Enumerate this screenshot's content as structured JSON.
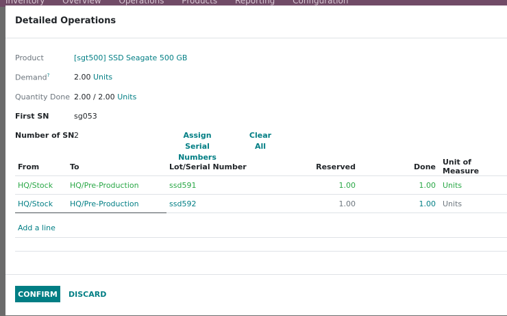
{
  "app_bar": {
    "items": [
      "Inventory",
      "Overview",
      "Operations",
      "Products",
      "Reporting",
      "Configuration"
    ]
  },
  "dialog": {
    "title": "Detailed Operations",
    "product": {
      "label": "Product",
      "value": "[sgt500] SSD Seagate 500 GB"
    },
    "demand": {
      "label": "Demand",
      "help": "?",
      "value": "2.00",
      "unit": "Units"
    },
    "quantity_done": {
      "label": "Quantity Done",
      "value": "2.00 / 2.00",
      "unit": "Units"
    },
    "first_sn": {
      "label": "First SN",
      "value": "sg053"
    },
    "number_of_sn": {
      "label": "Number of SN",
      "value": "2"
    },
    "assign_serial_numbers": {
      "line1": "Assign Serial",
      "line2": "Numbers"
    },
    "clear_all": {
      "line1": "Clear",
      "line2": "All"
    },
    "table": {
      "headers": [
        "From",
        "To",
        "Lot/Serial Number",
        "Reserved",
        "Done",
        "Unit of Measure"
      ],
      "rows": [
        {
          "from": "HQ/Stock",
          "to": "HQ/Pre-Production",
          "lot": "ssd591",
          "reserved": "1.00",
          "done": "1.00",
          "uom": "Units"
        },
        {
          "from": "HQ/Stock",
          "to": "HQ/Pre-Production",
          "lot": "ssd592",
          "reserved": "1.00",
          "done": "1.00",
          "uom": "Units"
        }
      ],
      "add_line": "Add a line"
    },
    "footer": {
      "confirm": "CONFIRM",
      "discard": "DISCARD"
    }
  }
}
